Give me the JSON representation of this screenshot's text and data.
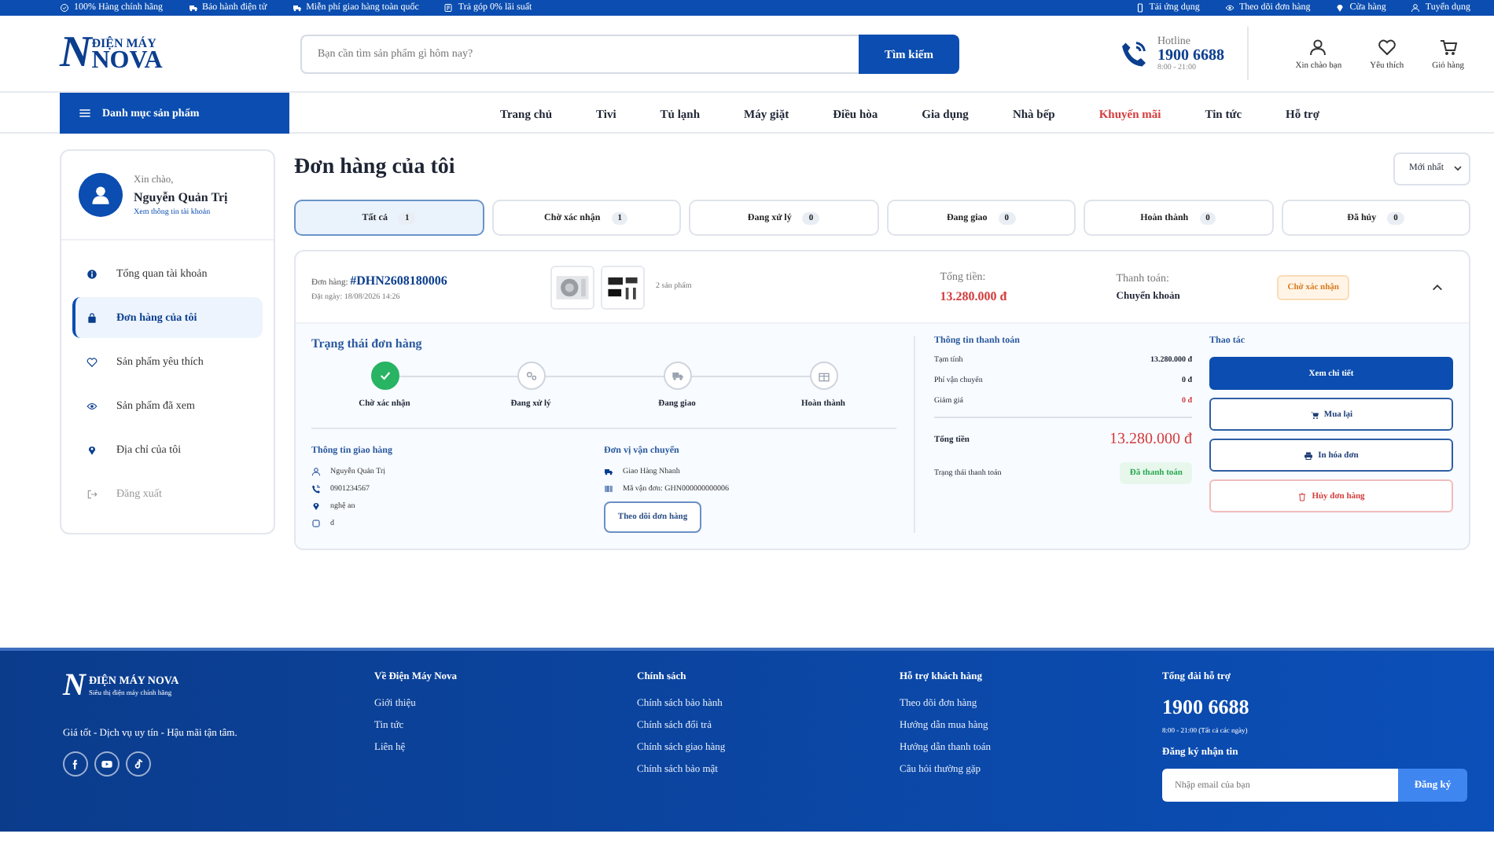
{
  "topbar": {
    "left": [
      {
        "text": "100% Hàng chính hãng"
      },
      {
        "text": "Bảo hành điện tử"
      },
      {
        "text": "Miễn phí giao hàng toàn quốc"
      },
      {
        "text": "Trả góp 0% lãi suất"
      }
    ],
    "right": [
      {
        "text": "Tải ứng dụng"
      },
      {
        "text": "Theo dõi đơn hàng"
      },
      {
        "text": "Cửa hàng"
      },
      {
        "text": "Tuyển dụng"
      }
    ]
  },
  "header": {
    "logo": {
      "letter": "N",
      "top": "ĐIỆN MÁY",
      "main": "NOVA"
    },
    "search": {
      "placeholder": "Bạn cần tìm sản phẩm gì hôm nay?",
      "button": "Tìm kiếm"
    },
    "hotline": {
      "label": "Hotline",
      "number": "1900 6688",
      "hours": "8:00 - 21:00"
    },
    "account": [
      {
        "label": "Xin chào bạn"
      },
      {
        "label": "Yêu thích"
      },
      {
        "label": "Giỏ hàng"
      }
    ]
  },
  "nav": {
    "category_button": "Danh mục sản phẩm",
    "links": [
      {
        "label": "Trang chủ",
        "kind": "normal"
      },
      {
        "label": "Tivi",
        "kind": "normal"
      },
      {
        "label": "Tủ lạnh",
        "kind": "normal"
      },
      {
        "label": "Máy giặt",
        "kind": "normal"
      },
      {
        "label": "Điều hòa",
        "kind": "normal"
      },
      {
        "label": "Gia dụng",
        "kind": "normal"
      },
      {
        "label": "Nhà bếp",
        "kind": "normal"
      },
      {
        "label": "Khuyến mãi",
        "kind": "promo"
      },
      {
        "label": "Tin tức",
        "kind": "normal"
      },
      {
        "label": "Hỗ trợ",
        "kind": "normal"
      }
    ]
  },
  "sidebar": {
    "greeting": "Xin chào,",
    "name": "Nguyễn Quản Trị",
    "profile_link": "Xem thông tin tài khoản",
    "items": [
      {
        "label": "Tổng quan tài khoản",
        "selected": false,
        "kind": "link"
      },
      {
        "label": "Đơn hàng của tôi",
        "selected": true,
        "kind": "link"
      },
      {
        "label": "Sản phẩm yêu thích",
        "selected": false,
        "kind": "link"
      },
      {
        "label": "Sản phẩm đã xem",
        "selected": false,
        "kind": "link"
      },
      {
        "label": "Địa chỉ của tôi",
        "selected": false,
        "kind": "link"
      },
      {
        "label": "Đăng xuất",
        "selected": false,
        "kind": "logout"
      }
    ]
  },
  "orders": {
    "title": "Đơn hàng của tôi",
    "sort": "Mới nhất",
    "tabs": [
      {
        "label": "Tất cả",
        "count": "1",
        "selected": true
      },
      {
        "label": "Chờ xác nhận",
        "count": "1",
        "selected": false
      },
      {
        "label": "Đang xử lý",
        "count": "0",
        "selected": false
      },
      {
        "label": "Đang giao",
        "count": "0",
        "selected": false
      },
      {
        "label": "Hoàn thành",
        "count": "0",
        "selected": false
      },
      {
        "label": "Đã hủy",
        "count": "0",
        "selected": false
      }
    ],
    "order": {
      "number_label": "Đơn hàng:",
      "number": "#DHN2608180006",
      "date": "Đặt ngày: 18/08/2026 14:26",
      "product_count": "2 sản phẩm",
      "total_label": "Tổng tiền:",
      "total": "13.280.000 đ",
      "payment_label": "Thanh toán:",
      "payment": "Chuyển khoản",
      "status": "Chờ xác nhận",
      "expanded": true,
      "progress": {
        "title": "Trạng thái đơn hàng",
        "steps": [
          {
            "label": "Chờ xác nhận",
            "done": true
          },
          {
            "label": "Đang xử lý",
            "done": false
          },
          {
            "label": "Đang giao",
            "done": false
          },
          {
            "label": "Hoàn thành",
            "done": false
          }
        ]
      },
      "shipping": {
        "title": "Thông tin giao hàng",
        "lines": [
          "Nguyễn Quản Trị",
          "0901234567",
          "nghệ an",
          "d"
        ]
      },
      "carrier": {
        "title": "Đơn vị vận chuyển",
        "lines": [
          "Giao Hàng Nhanh",
          "Mã vận đơn: GHN000000000006"
        ],
        "button": "Theo dõi đơn hàng"
      },
      "payment_info": {
        "title": "Thông tin thanh toán",
        "rows": [
          {
            "label": "Tạm tính",
            "value": "13.280.000 đ",
            "kind": "normal"
          },
          {
            "label": "Phí vận chuyển",
            "value": "0 đ",
            "kind": "normal"
          },
          {
            "label": "Giảm giá",
            "value": "0 đ",
            "kind": "discount"
          }
        ],
        "total_label": "Tổng tiền",
        "total": "13.280.000 đ",
        "status_label": "Trạng thái thanh toán",
        "status": "Đã thanh toán"
      },
      "actions": {
        "title": "Thao tác",
        "buttons": [
          {
            "label": "Xem chi tiết",
            "kind": "primary"
          },
          {
            "label": "Mua lại",
            "kind": "buy"
          },
          {
            "label": "In hóa đơn",
            "kind": "print"
          },
          {
            "label": "Hủy đơn hàng",
            "kind": "danger"
          }
        ]
      }
    }
  },
  "footer": {
    "brand": {
      "letter": "N",
      "name": "ĐIỆN MÁY NOVA",
      "tagline": "Siêu thị điện máy chính hãng"
    },
    "slogan": "Giá tốt - Dịch vụ uy tín - Hậu mãi tận tâm.",
    "columns": [
      {
        "title": "Về Điện Máy Nova",
        "links": [
          "Giới thiệu",
          "Tin tức",
          "Liên hệ"
        ]
      },
      {
        "title": "Chính sách",
        "links": [
          "Chính sách bảo hành",
          "Chính sách đổi trả",
          "Chính sách giao hàng",
          "Chính sách bảo mật"
        ]
      },
      {
        "title": "Hỗ trợ khách hàng",
        "links": [
          "Theo dõi đơn hàng",
          "Hướng dẫn mua hàng",
          "Hướng dẫn thanh toán",
          "Câu hỏi thường gặp"
        ]
      }
    ],
    "support": {
      "title": "Tổng đài hỗ trợ",
      "phone": "1900 6688",
      "hours": "8:00 - 21:00 (Tất cả các ngày)",
      "newsletter_title": "Đăng ký nhận tin",
      "email_placeholder": "Nhập email của bạn",
      "subscribe_button": "Đăng ký"
    }
  }
}
